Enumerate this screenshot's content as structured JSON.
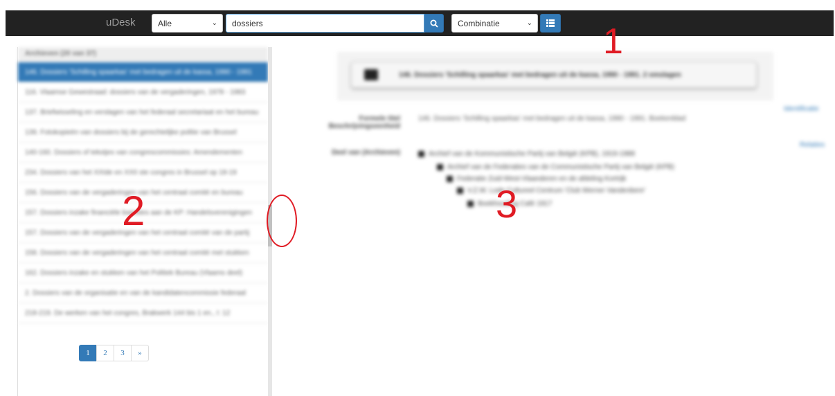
{
  "header": {
    "brand": "uDesk",
    "scope_select": "Alle",
    "search_value": "dossiers",
    "mode_select": "Combinatie"
  },
  "annotations": {
    "marker1": "1",
    "marker2": "2",
    "marker3": "3"
  },
  "results": {
    "heading": "Archieven (20 van 37)",
    "items": [
      "146. Dossiers 'Schilling spaarkas' met bedragen uit de kassa, 1990 - 1991",
      "116. Vlaamse Gewestraad: dossiers van de vergaderingen, 1978 - 1983",
      "137. Briefwisseling en verslagen van het federaal secretariaat en het bureau",
      "139. Fotokopieën van dossiers bij de gerechtelijke politie van Brussel",
      "140-160. Dossiers of tekstjes van congrescommissies: Amendementen",
      "234. Dossiers van het XXIde en XXII ste congres in Brussel op 18-19",
      "156. Dossiers van de vergaderingen van het centraal comité en bureau",
      "157. Dossiers inzake financiële kwesties aan de KP: Handelsverenigingen",
      "157. Dossiers van de vergaderingen van het centraal comité van de partij",
      "158. Dossiers van de vergaderingen van het centraal comité met stukken",
      "162. Dossiers inzake en stukken van het Politiek Bureau (Vlaams deel)",
      "2. Dossiers van de organisatie en van de kandidatencommissie federaal",
      "218-219. De werken van het congres, Brakwerk 144 bis 1 en., I: 12"
    ],
    "pagination": [
      "1",
      "2",
      "3",
      "»"
    ]
  },
  "detail": {
    "title": "146. Dossiers 'Schilling spaarkas' met bedragen uit de kassa, 1990 - 1991. 2 omslagen",
    "formal_label": "Formele titel Beschrijvingseenheid",
    "formal_value": "146. Dossiers 'Schilling spaarkas' met bedragen uit de kassa, 1990 - 1991. Boekenblad",
    "part_label": "Deel van (Archieven)",
    "tree": [
      "Archief van de Kommunistische Partij van België (KPB), 1919-1988",
      "Archief van de Federaties van de Communistische Partij van België (KPB)",
      "Federatie Zuid-West-Vlaanderen en de afdeling Kortrijk",
      "V.Z.W. Lode Cultureel Centrum 'Club Werner Vandenbere'",
      "Boekhouding Café 1917"
    ],
    "side_links": [
      "Identificatie",
      "Relaties"
    ]
  }
}
